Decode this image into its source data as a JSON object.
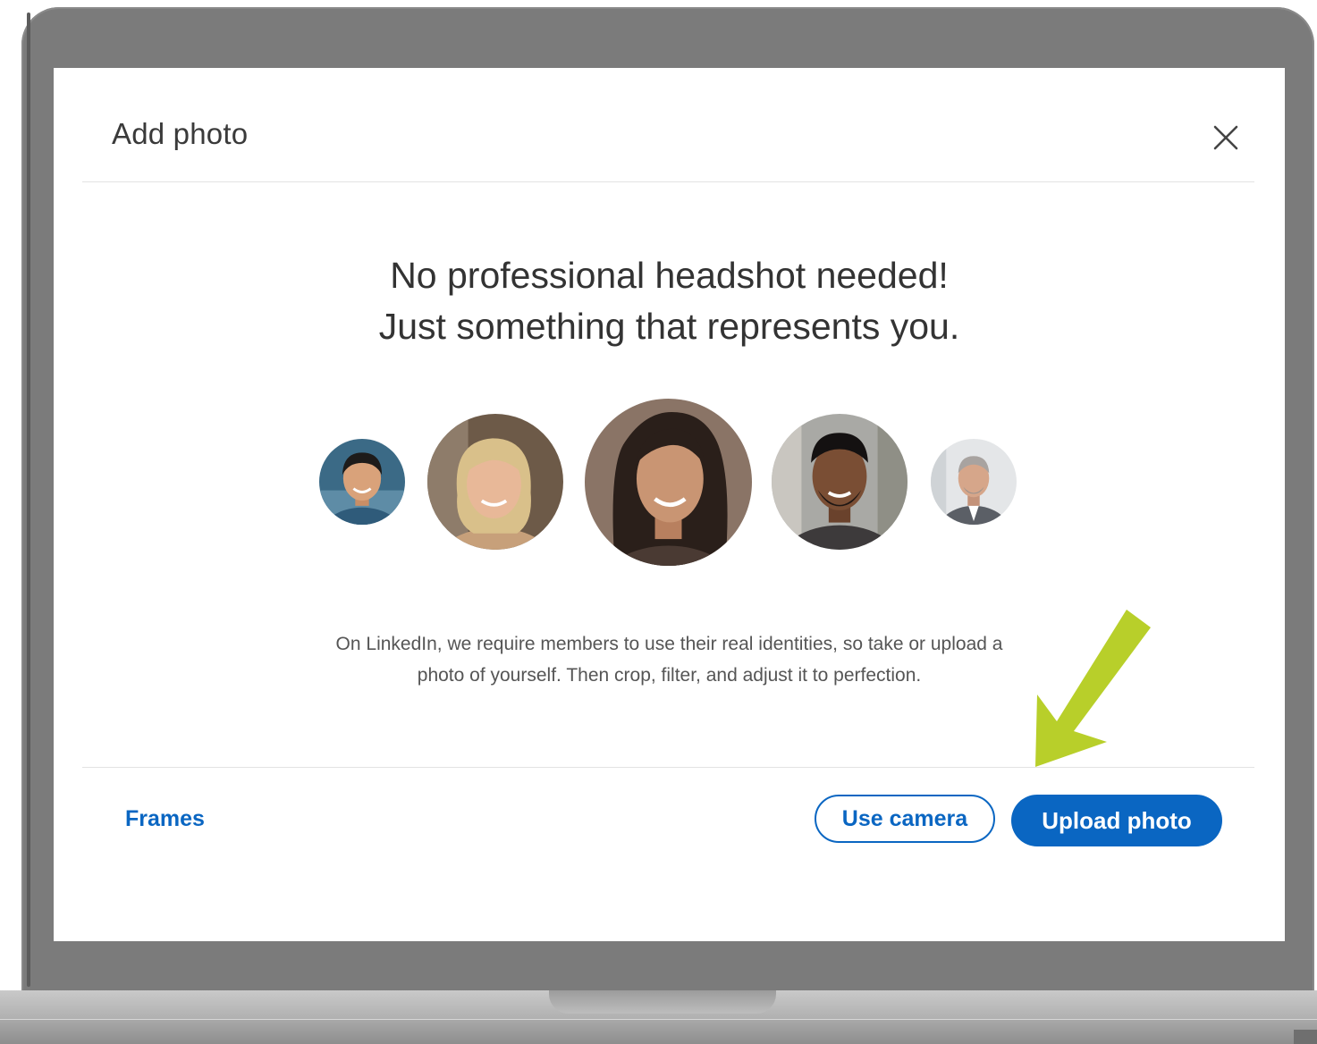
{
  "modal": {
    "title": "Add photo",
    "close_icon": "close-icon"
  },
  "headline": {
    "line1": "No professional headshot needed!",
    "line2": "Just something that represents you."
  },
  "avatars": [
    {
      "name": "avatar-1",
      "skin": "#d9a27a",
      "hair": "#1d1b1a",
      "bg": "#3b6a86",
      "shirt": "#2f5b7a"
    },
    {
      "name": "avatar-2",
      "skin": "#e8b898",
      "hair": "#d9c08a",
      "bg": "#6d5a48",
      "shirt": "#c7a07a"
    },
    {
      "name": "avatar-3",
      "skin": "#c99573",
      "hair": "#2a1f1a",
      "bg": "#8a7466",
      "shirt": "#4a3a33"
    },
    {
      "name": "avatar-4",
      "skin": "#7a4e34",
      "hair": "#141111",
      "bg": "#a9a9a5",
      "shirt": "#3d3a3b"
    },
    {
      "name": "avatar-5",
      "skin": "#d6a68a",
      "hair": "#a8a3a0",
      "bg": "#e4e6e8",
      "shirt": "#5b5f66"
    }
  ],
  "description": {
    "line1": "On LinkedIn, we require members to use their real identities, so take or upload a",
    "line2": "photo of yourself. Then crop, filter, and adjust it to perfection."
  },
  "footer": {
    "frames_label": "Frames",
    "use_camera_label": "Use camera",
    "upload_photo_label": "Upload photo"
  },
  "colors": {
    "primary": "#0a66c2",
    "arrow": "#b8cf2a",
    "bezel": "#7b7b7b"
  }
}
